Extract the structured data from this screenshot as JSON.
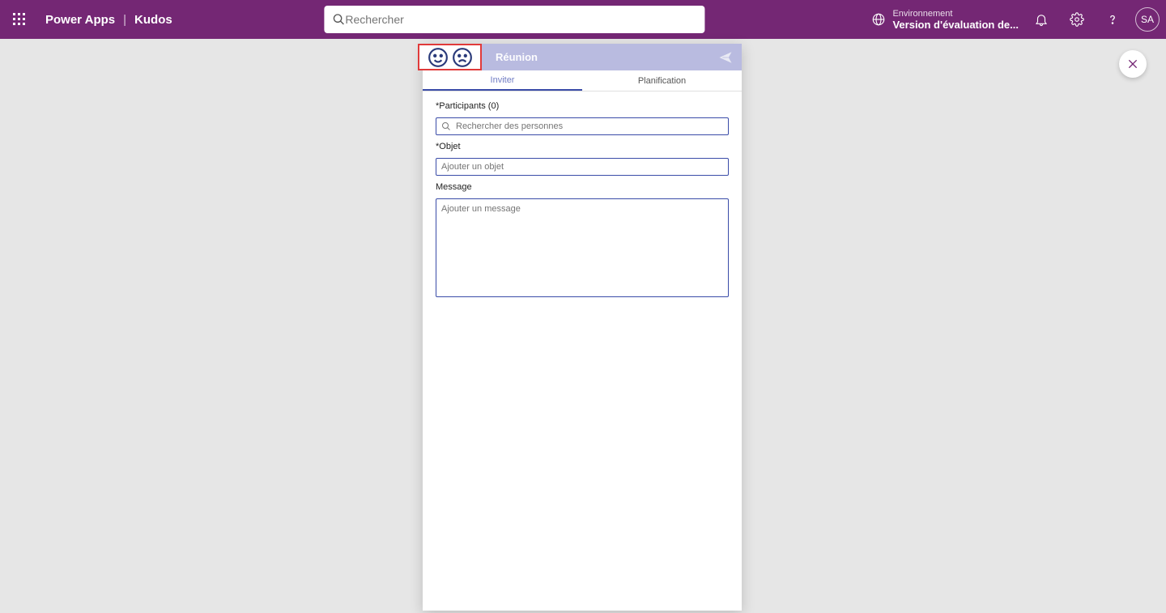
{
  "header": {
    "brand": "Power Apps",
    "app_name": "Kudos",
    "search_placeholder": "Rechercher",
    "environment_label": "Environnement",
    "environment_name": "Version d'évaluation de...",
    "user_initials": "SA"
  },
  "panel": {
    "title": "Réunion",
    "tabs": [
      {
        "label": "Inviter",
        "active": true
      },
      {
        "label": "Planification",
        "active": false
      }
    ],
    "participants_label": "*Participants (0)",
    "participants_placeholder": "Rechercher des personnes",
    "subject_label": "*Objet",
    "subject_placeholder": "Ajouter un objet",
    "message_label": "Message",
    "message_placeholder": "Ajouter un message"
  }
}
